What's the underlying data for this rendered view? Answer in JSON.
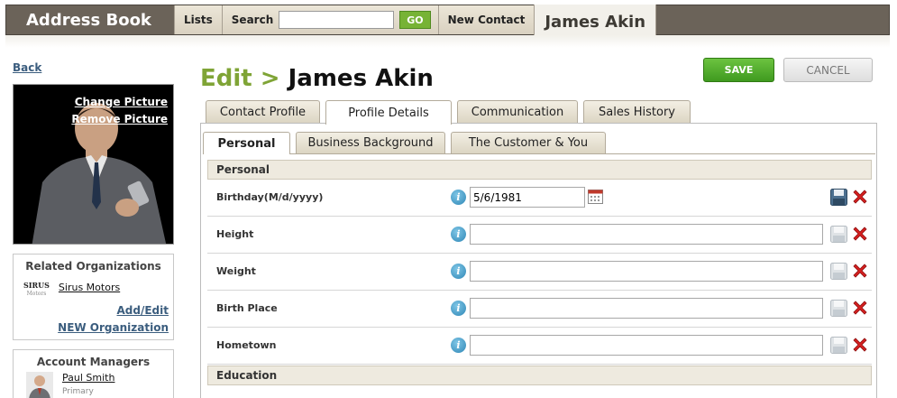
{
  "topbar": {
    "brand": "Address Book",
    "lists": "Lists",
    "search_label": "Search",
    "search_value": "",
    "go": "GO",
    "new_contact": "New Contact",
    "current_contact": "James Akin"
  },
  "sidebar": {
    "back": "Back",
    "change_picture": "Change Picture",
    "remove_picture": "Remove Picture",
    "related_orgs_title": "Related Organizations",
    "org_logo_top": "SIRUS",
    "org_logo_bottom": "Motors",
    "org_name": "Sirus Motors",
    "add_edit": "Add/Edit",
    "new_org": "NEW Organization",
    "account_managers_title": "Account Managers",
    "manager_name": "Paul Smith",
    "manager_role": "Primary"
  },
  "header": {
    "edit": "Edit >",
    "name": "James Akin",
    "save": "SAVE",
    "cancel": "CANCEL"
  },
  "tabs": [
    "Contact Profile",
    "Profile Details",
    "Communication",
    "Sales History"
  ],
  "subtabs": [
    "Personal",
    "Business Background",
    "The Customer & You"
  ],
  "sections": {
    "personal": "Personal",
    "education": "Education"
  },
  "fields": [
    {
      "label": "Birthday(M/d/yyyy)",
      "value": "5/6/1981"
    },
    {
      "label": "Height",
      "value": ""
    },
    {
      "label": "Weight",
      "value": ""
    },
    {
      "label": "Birth Place",
      "value": ""
    },
    {
      "label": "Hometown",
      "value": ""
    }
  ],
  "colors": {
    "accent_green": "#7fa436",
    "save_green": "#4caf2a",
    "topbar": "#6b6359",
    "delete_red": "#d62020",
    "info_blue": "#2f87b6"
  }
}
